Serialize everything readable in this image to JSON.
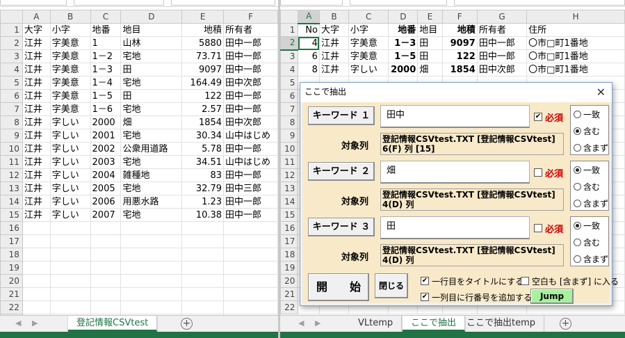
{
  "left": {
    "columns": [
      "A",
      "B",
      "C",
      "D",
      "E",
      "F"
    ],
    "rows": [
      [
        "大字",
        "小字",
        "地番",
        "地目",
        "地積",
        "所有者"
      ],
      [
        "江井",
        "字美意",
        "1",
        "山林",
        "5880",
        "田中一郎"
      ],
      [
        "江井",
        "字美意",
        "1－2",
        "宅地",
        "73.71",
        "田中一郎"
      ],
      [
        "江井",
        "字美意",
        "1－3",
        "田",
        "9097",
        "田中一郎"
      ],
      [
        "江井",
        "字美意",
        "1－4",
        "宅地",
        "164.49",
        "田中次郎"
      ],
      [
        "江井",
        "字美意",
        "1－5",
        "田",
        "122",
        "田中一郎"
      ],
      [
        "江井",
        "字美意",
        "1－6",
        "宅地",
        "2.57",
        "田中一郎"
      ],
      [
        "江井",
        "字しい",
        "2000",
        "畑",
        "1854",
        "田中次郎"
      ],
      [
        "江井",
        "字しい",
        "2001",
        "宅地",
        "30.34",
        "山中はじめ"
      ],
      [
        "江井",
        "字しい",
        "2002",
        "公衆用道路",
        "5.78",
        "田中一郎"
      ],
      [
        "江井",
        "字しい",
        "2003",
        "宅地",
        "34.51",
        "山中はじめ"
      ],
      [
        "江井",
        "字しい",
        "2004",
        "雑種地",
        "83",
        "田中一郎"
      ],
      [
        "江井",
        "字しい",
        "2005",
        "宅地",
        "32.79",
        "田中三郎"
      ],
      [
        "江井",
        "字しい",
        "2006",
        "用悪水路",
        "1.23",
        "田中一郎"
      ],
      [
        "江井",
        "字しい",
        "2007",
        "宅地",
        "10.38",
        "田中一郎"
      ],
      [
        "",
        "",
        "",
        "",
        "",
        ""
      ],
      [
        "",
        "",
        "",
        "",
        "",
        ""
      ],
      [
        "",
        "",
        "",
        "",
        "",
        ""
      ],
      [
        "",
        "",
        "",
        "",
        "",
        ""
      ],
      [
        "",
        "",
        "",
        "",
        "",
        ""
      ],
      [
        "",
        "",
        "",
        "",
        "",
        ""
      ],
      [
        "",
        "",
        "",
        "",
        "",
        ""
      ],
      [
        "",
        "",
        "",
        "",
        "",
        ""
      ]
    ],
    "tabs": [
      "登記情報CSVtest"
    ],
    "add_sheet": "+"
  },
  "right": {
    "columns": [
      "A",
      "B",
      "C",
      "D",
      "E",
      "F",
      "G",
      "H"
    ],
    "rows": [
      [
        "No",
        "大字",
        "小字",
        "地番",
        "地目",
        "地積",
        "所有者",
        "住所"
      ],
      [
        "4",
        "江井",
        "字美意",
        "1－3",
        "田",
        "9097",
        "田中一郎",
        "〇市□町1番地"
      ],
      [
        "6",
        "江井",
        "字美意",
        "1－5",
        "田",
        "122",
        "田中一郎",
        "〇市□町1番地"
      ],
      [
        "8",
        "江井",
        "字しい",
        "2000",
        "畑",
        "1854",
        "田中次郎",
        "〇市□町1番地"
      ],
      [
        "",
        "",
        "",
        "",
        "",
        "",
        "",
        ""
      ],
      [
        "",
        "",
        "",
        "",
        "",
        "",
        "",
        ""
      ],
      [
        "",
        "",
        "",
        "",
        "",
        "",
        "",
        ""
      ],
      [
        "",
        "",
        "",
        "",
        "",
        "",
        "",
        ""
      ],
      [
        "",
        "",
        "",
        "",
        "",
        "",
        "",
        ""
      ],
      [
        "",
        "",
        "",
        "",
        "",
        "",
        "",
        ""
      ],
      [
        "",
        "",
        "",
        "",
        "",
        "",
        "",
        ""
      ],
      [
        "",
        "",
        "",
        "",
        "",
        "",
        "",
        ""
      ],
      [
        "",
        "",
        "",
        "",
        "",
        "",
        "",
        ""
      ],
      [
        "",
        "",
        "",
        "",
        "",
        "",
        "",
        ""
      ],
      [
        "",
        "",
        "",
        "",
        "",
        "",
        "",
        ""
      ],
      [
        "",
        "",
        "",
        "",
        "",
        "",
        "",
        ""
      ],
      [
        "",
        "",
        "",
        "",
        "",
        "",
        "",
        ""
      ],
      [
        "",
        "",
        "",
        "",
        "",
        "",
        "",
        ""
      ],
      [
        "",
        "",
        "",
        "",
        "",
        "",
        "",
        ""
      ],
      [
        "",
        "",
        "",
        "",
        "",
        "",
        "",
        ""
      ],
      [
        "",
        "",
        "",
        "",
        "",
        "",
        "",
        ""
      ],
      [
        "",
        "",
        "",
        "",
        "",
        "",
        "",
        ""
      ]
    ],
    "tabs": [
      "VLtemp",
      "ここで抽出",
      "ここで抽出temp"
    ],
    "add_sheet": "+"
  },
  "dialog": {
    "title": "ここで抽出",
    "close": "✕",
    "target_label": "対象列",
    "required": "必須",
    "options": [
      "一致",
      "含む",
      "含まず"
    ],
    "keywords": [
      {
        "button": "キーワード １",
        "value": "田中",
        "target": "登記情報CSVtest.TXT [登記情報CSVtest] 6(F) 列 [15]",
        "required_checked": true,
        "option": 1
      },
      {
        "button": "キーワード ２",
        "value": "畑",
        "target": "登記情報CSVtest.TXT [登記情報CSVtest] 4(D) 列",
        "required_checked": false,
        "option": 0
      },
      {
        "button": "キーワード ３",
        "value": "田",
        "target": "登記情報CSVtest.TXT [登記情報CSVtest] 4(D) 列",
        "required_checked": false,
        "option": 0
      }
    ],
    "start_label": "開　　始",
    "close_label": "閉じる",
    "chk_title_row": "一行目をタイトルにする",
    "chk_row_number": "一列目に行番号を追加する",
    "chk_blank": "空白も [含まず] に入る",
    "jump_label": "Jump"
  }
}
